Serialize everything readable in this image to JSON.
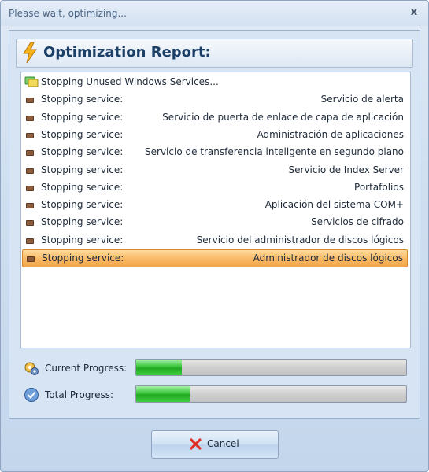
{
  "window": {
    "title": "Please wait, optimizing...",
    "close_glyph": "x"
  },
  "header": {
    "title": "Optimization Report:",
    "icon": "lightning-bolt-icon"
  },
  "report": {
    "group_label": "Stopping Unused Windows Services...",
    "group_icon": "services-icon",
    "items": [
      {
        "label": "Stopping service:",
        "value": "Servicio de alerta"
      },
      {
        "label": "Stopping service:",
        "value": "Servicio de puerta de enlace de capa de aplicación"
      },
      {
        "label": "Stopping service:",
        "value": "Administración de aplicaciones"
      },
      {
        "label": "Stopping service:",
        "value": "Servicio de transferencia inteligente en segundo plano"
      },
      {
        "label": "Stopping service:",
        "value": "Servicio de Index Server"
      },
      {
        "label": "Stopping service:",
        "value": "Portafolios"
      },
      {
        "label": "Stopping service:",
        "value": "Aplicación del sistema COM+"
      },
      {
        "label": "Stopping service:",
        "value": "Servicios de cifrado"
      },
      {
        "label": "Stopping service:",
        "value": "Servicio del administrador de discos lógicos"
      },
      {
        "label": "Stopping service:",
        "value": "Administrador de discos lógicos"
      }
    ],
    "selected_index": 9
  },
  "progress": {
    "current": {
      "label": "Current Progress:",
      "fraction": 0.17,
      "icon": "gears-icon"
    },
    "total": {
      "label": "Total Progress:",
      "fraction": 0.2,
      "icon": "checkmark-circle-icon"
    }
  },
  "buttons": {
    "cancel_label": "Cancel"
  },
  "colors": {
    "accent": "#1c3f68",
    "selection": "#f8b661",
    "progress_fill": "#2fb52f"
  }
}
